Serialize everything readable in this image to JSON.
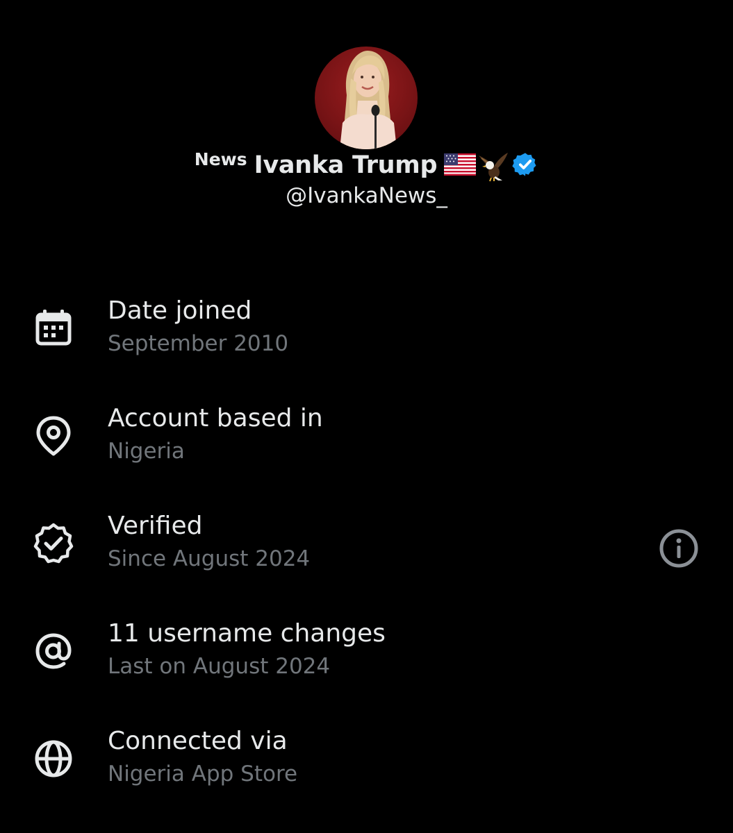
{
  "profile": {
    "name_prefix": "News",
    "display_name": "Ivanka Trump",
    "handle": "@IvankaNews_",
    "avatar_icon": "profile-photo",
    "verified_badge_color": "#1d9bf0"
  },
  "details": [
    {
      "icon": "calendar-icon",
      "title": "Date joined",
      "subtitle": "September 2010"
    },
    {
      "icon": "location-pin-icon",
      "title": "Account based in",
      "subtitle": "Nigeria"
    },
    {
      "icon": "verified-badge-icon",
      "title": "Verified",
      "subtitle": "Since August 2024",
      "action_icon": "info-icon"
    },
    {
      "icon": "at-sign-icon",
      "title": "11 username changes",
      "subtitle": "Last on August 2024"
    },
    {
      "icon": "globe-icon",
      "title": "Connected via",
      "subtitle": "Nigeria App Store"
    }
  ],
  "colors": {
    "background": "#000000",
    "primary_text": "#e7e9ea",
    "secondary_text": "#71767b",
    "accent_blue": "#1d9bf0"
  }
}
